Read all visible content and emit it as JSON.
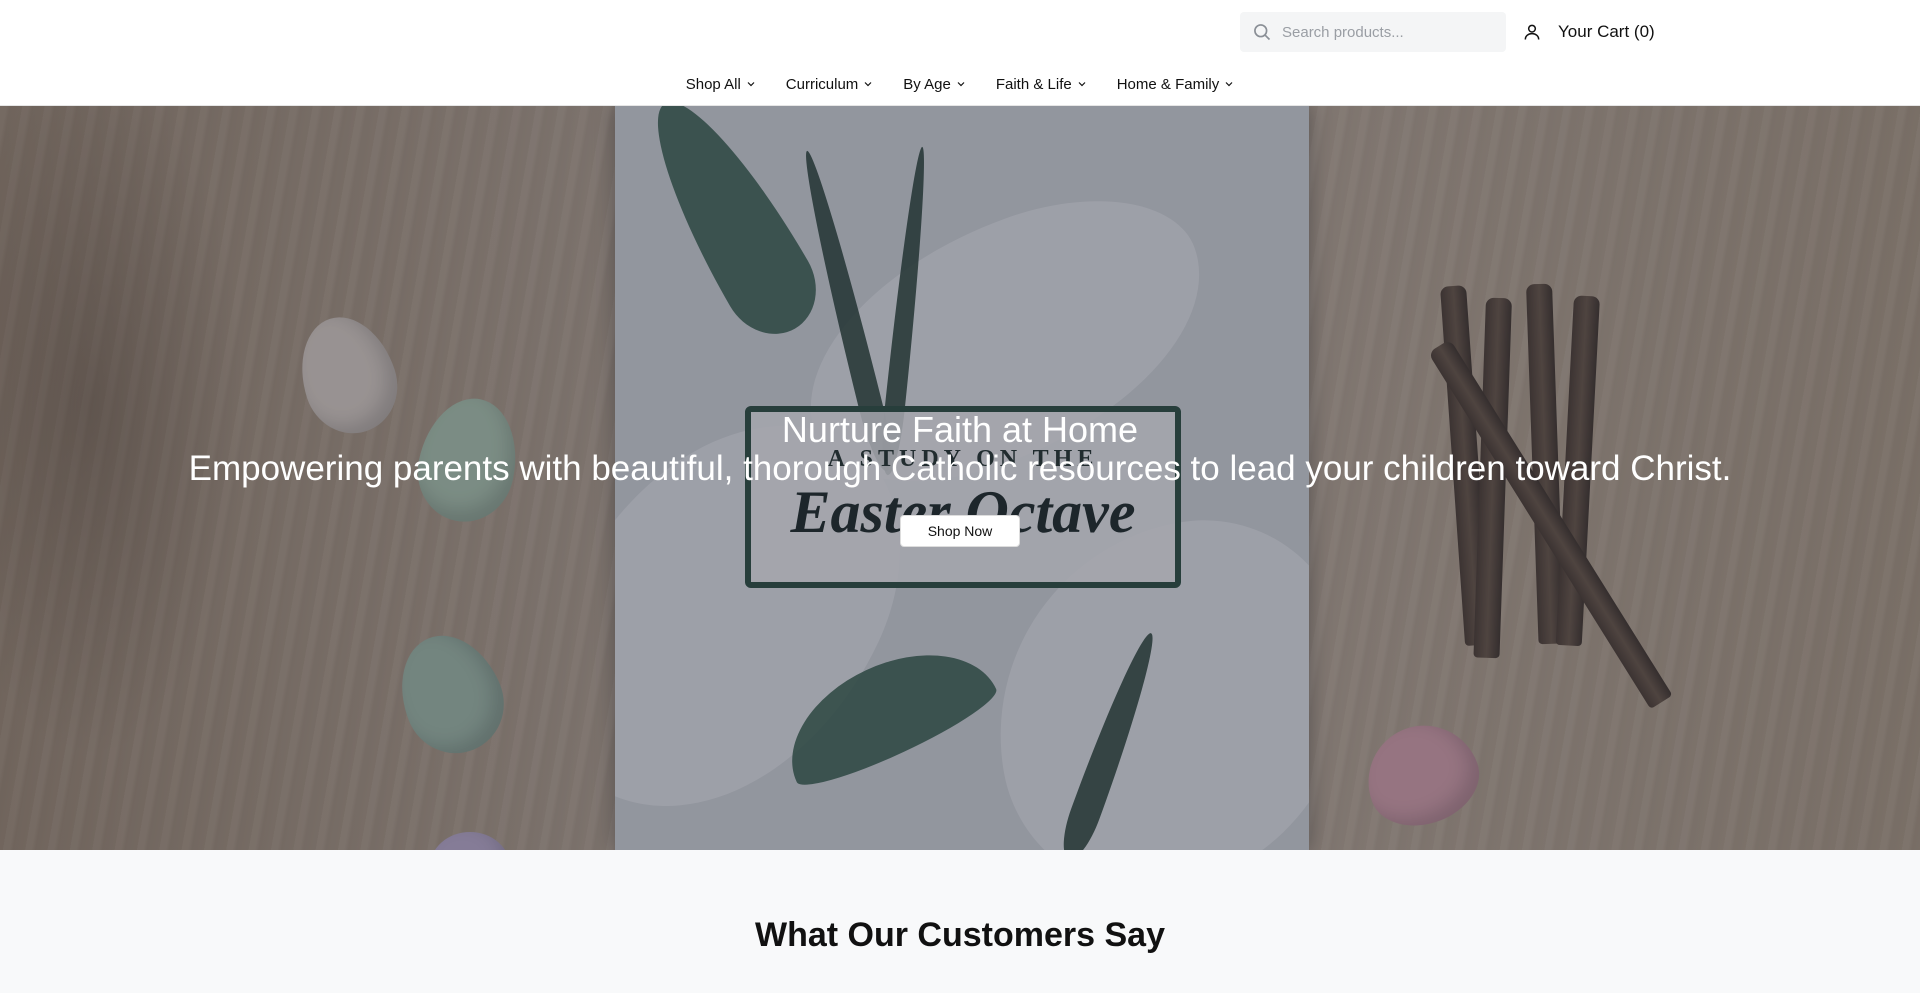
{
  "header": {
    "search": {
      "placeholder": "Search products..."
    },
    "cart_label": "Your Cart (0)"
  },
  "nav": {
    "items": [
      {
        "label": "Shop All"
      },
      {
        "label": "Curriculum"
      },
      {
        "label": "By Age"
      },
      {
        "label": "Faith & Life"
      },
      {
        "label": "Home & Family"
      }
    ]
  },
  "hero": {
    "title": "Nurture Faith at Home",
    "subtitle": "Empowering parents with beautiful, thorough Catholic resources to lead your children toward Christ.",
    "cta_label": "Shop Now",
    "image": {
      "book_subtitle": "A STUDY ON THE",
      "book_title": "Easter Octave"
    }
  },
  "testimonials": {
    "heading": "What Our Customers Say"
  },
  "icons": {
    "search": "search-icon",
    "account": "user-icon",
    "dropdown": "chevron-down-icon"
  }
}
